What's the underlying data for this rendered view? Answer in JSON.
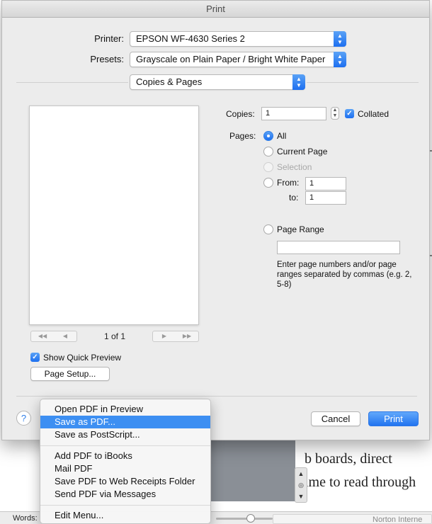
{
  "dialog": {
    "title": "Print"
  },
  "printer": {
    "label": "Printer:",
    "value": "EPSON WF-4630 Series 2"
  },
  "presets": {
    "label": "Presets:",
    "value": "Grayscale on Plain Paper / Bright White Paper"
  },
  "section": {
    "value": "Copies & Pages"
  },
  "preview": {
    "page_count": "1 of 1",
    "show_quick_preview": "Show Quick Preview",
    "show_quick_preview_checked": true,
    "page_setup_label": "Page Setup..."
  },
  "copies": {
    "label": "Copies:",
    "value": "1",
    "collated_label": "Collated",
    "collated_checked": true
  },
  "pages": {
    "label": "Pages:",
    "options": {
      "all": "All",
      "current_page": "Current Page",
      "selection": "Selection",
      "from": "From:",
      "to": "to:",
      "page_range": "Page Range"
    },
    "selected": "all",
    "from_value": "1",
    "to_value": "1",
    "range_value": "",
    "range_hint": "Enter page numbers and/or page ranges separated by commas (e.g. 2, 5-8)"
  },
  "buttons": {
    "help": "?",
    "cancel": "Cancel",
    "print": "Print"
  },
  "pdf_menu": {
    "items": [
      {
        "label": "Open PDF in Preview",
        "active": false
      },
      {
        "label": "Save as PDF...",
        "active": true
      },
      {
        "label": "Save as PostScript...",
        "active": false
      },
      {
        "label": "Add PDF to iBooks",
        "active": false
      },
      {
        "label": "Mail PDF",
        "active": false
      },
      {
        "label": "Save PDF to Web Receipts Folder",
        "active": false
      },
      {
        "label": "Send PDF via Messages",
        "active": false
      },
      {
        "label": "Edit Menu...",
        "active": false
      }
    ]
  },
  "background_document": {
    "line1": "b boards, direct",
    "line2": "ime to read through",
    "words_label": "Words:",
    "norton_label": "Norton Interne"
  },
  "colors": {
    "accent": "#2274f0",
    "menu_highlight": "#3d8ff2"
  }
}
